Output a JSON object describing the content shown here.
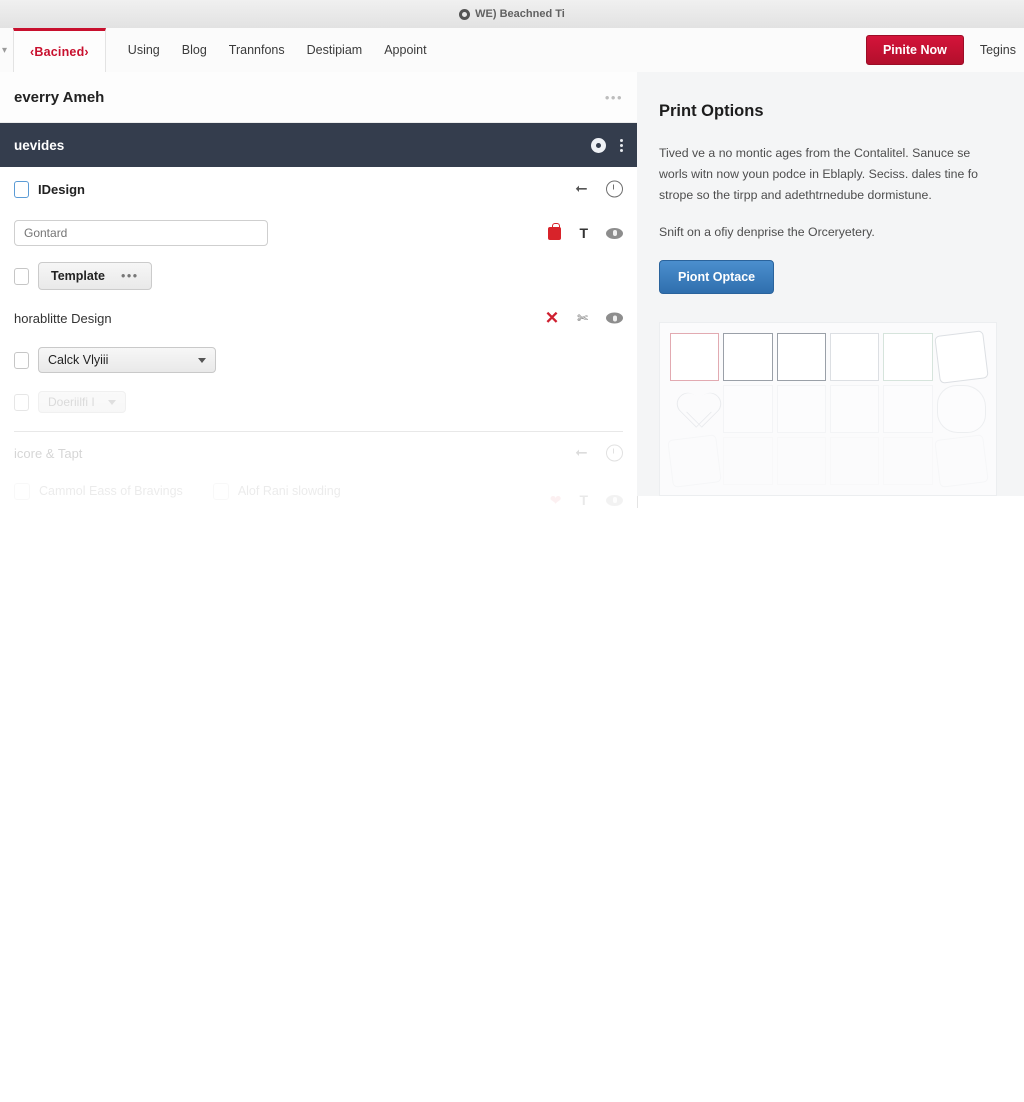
{
  "window": {
    "title": "WE) Beachned Ti",
    "icon": "circle-target-icon"
  },
  "navbar": {
    "caret": "▾",
    "brand": "‹Bacined›",
    "items": [
      {
        "label": "Using"
      },
      {
        "label": "Blog"
      },
      {
        "label": "Trannfons"
      },
      {
        "label": "Destipiam"
      },
      {
        "label": "Appoint"
      }
    ],
    "cta_label": "Pinite Now",
    "signin_label": "Tegins",
    "cta_color": "#c4123a",
    "brand_color": "#c8102e"
  },
  "card": {
    "title": "everry Ameh",
    "menu_dots": "•••",
    "dark_bar": {
      "title": "uevides",
      "record_icon": "record-circle-icon",
      "menu_icon": "kebab-menu-icon",
      "background": "#343d4d"
    },
    "rows": [
      {
        "type": "checkbox-label",
        "label": "IDesign",
        "actions": [
          "arrow-icon",
          "clock-icon"
        ]
      },
      {
        "type": "text-input",
        "value": "Gontard",
        "placeholder": "Gontard",
        "actions": [
          "bag-icon",
          "text-icon",
          "eye-icon"
        ]
      },
      {
        "type": "button",
        "label": "Template",
        "dots": "•••"
      },
      {
        "type": "label",
        "label": "horablitte Design",
        "actions": [
          "close-icon",
          "scissors-icon",
          "eye-icon"
        ]
      },
      {
        "type": "select",
        "label": "Calck Vlyiii",
        "caret": "▾"
      },
      {
        "type": "select-small",
        "label": "Doeriilfi I",
        "caret": "▾"
      },
      {
        "type": "label",
        "label": "icore & Tapt",
        "actions": [
          "arrow-icon",
          "clock-icon"
        ]
      }
    ],
    "inline_checkboxes": [
      {
        "label": "Cammol Eass of Bravings"
      },
      {
        "label": "Alof Rani slowding"
      }
    ],
    "trailing_actions": [
      "heart-icon",
      "text-icon",
      "eye-icon"
    ]
  },
  "right_panel": {
    "title": "Print Options",
    "paragraphs": [
      "Tived ve a no montic ages from the Contalitel. Sanuce se\nworls witn now youn podce in Eblaply. Seciss. dales tine fo\nstrope so the tirpp and adethtrnedube dormistune.",
      "Snift on a ofiy denprise the Orceryetery."
    ],
    "button_label": "Piont Optace",
    "button_color": "#3a7bb8",
    "background": "#f4f5f6",
    "thumbnails": {
      "row1": [
        "red-square",
        "dark-square",
        "dark-square",
        "grey-square",
        "green-square",
        "tilted-square"
      ],
      "row2": [
        "heart-shape",
        "faint-square",
        "faint-square",
        "faint-square",
        "faint-square",
        "blob-shape"
      ],
      "row3": [
        "tilted-square",
        "faint-square",
        "faint-square",
        "faint-square",
        "faint-square",
        "tilted-square"
      ]
    }
  }
}
